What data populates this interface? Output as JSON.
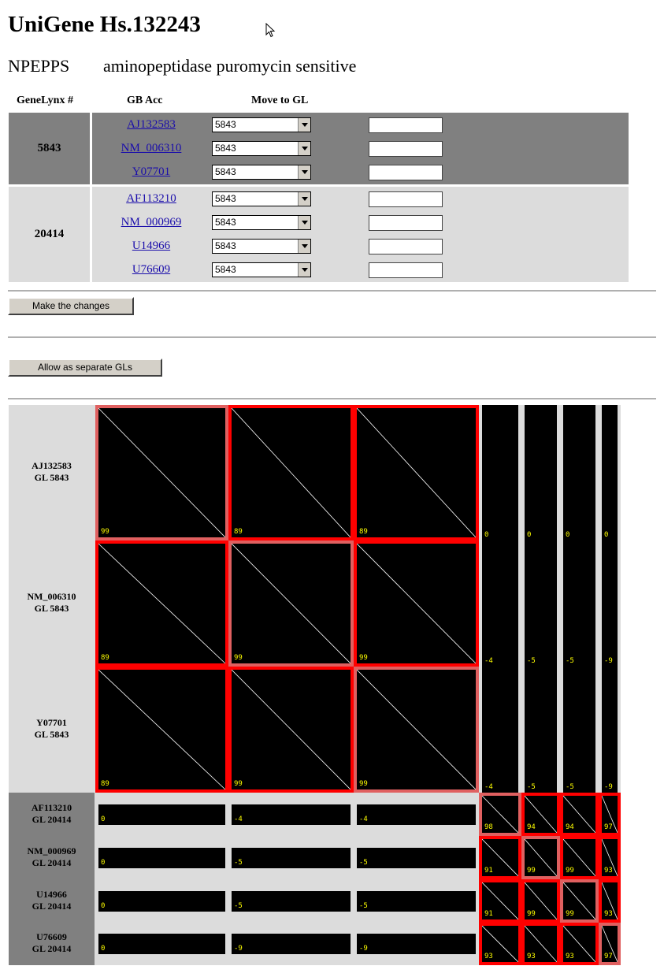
{
  "page": {
    "title": "UniGene Hs.132243",
    "gene_symbol": "NPEPPS",
    "gene_description": "aminopeptidase puromycin sensitive"
  },
  "table": {
    "headers": {
      "genelynx": "GeneLynx #",
      "gb_acc": "GB Acc",
      "move_to_gl": "Move to GL"
    },
    "groups": [
      {
        "gl": "5843",
        "color": "#808080",
        "rows": [
          {
            "acc": "AJ132583",
            "select_value": "5843",
            "input_value": ""
          },
          {
            "acc": "NM_006310",
            "select_value": "5843",
            "input_value": ""
          },
          {
            "acc": "Y07701",
            "select_value": "5843",
            "input_value": ""
          }
        ]
      },
      {
        "gl": "20414",
        "color": "#dcdcdc",
        "rows": [
          {
            "acc": "AF113210",
            "select_value": "5843",
            "input_value": ""
          },
          {
            "acc": "NM_000969",
            "select_value": "5843",
            "input_value": ""
          },
          {
            "acc": "U14966",
            "select_value": "5843",
            "input_value": ""
          },
          {
            "acc": "U76609",
            "select_value": "5843",
            "input_value": ""
          }
        ]
      }
    ]
  },
  "buttons": {
    "make_changes": "Make the changes",
    "allow_separate": "Allow as separate GLs"
  },
  "matrix": {
    "rows": [
      {
        "acc": "AJ132583",
        "gl": "GL 5843"
      },
      {
        "acc": "NM_006310",
        "gl": "GL 5843"
      },
      {
        "acc": "Y07701",
        "gl": "GL 5843"
      },
      {
        "acc": "AF113210",
        "gl": "GL 20414"
      },
      {
        "acc": "NM_000969",
        "gl": "GL 20414"
      },
      {
        "acc": "U14966",
        "gl": "GL 20414"
      },
      {
        "acc": "U76609",
        "gl": "GL 20414"
      }
    ],
    "scores": [
      [
        "99",
        "89",
        "89",
        "0",
        "0",
        "0",
        "0"
      ],
      [
        "89",
        "99",
        "99",
        "-4",
        "-5",
        "-5",
        "-9"
      ],
      [
        "89",
        "99",
        "99",
        "-4",
        "-5",
        "-5",
        "-9"
      ],
      [
        "0",
        "-4",
        "-4",
        "98",
        "94",
        "94",
        "97"
      ],
      [
        "0",
        "-5",
        "-5",
        "91",
        "99",
        "99",
        "93"
      ],
      [
        "0",
        "-5",
        "-5",
        "91",
        "99",
        "99",
        "93"
      ],
      [
        "0",
        "-9",
        "-9",
        "93",
        "93",
        "93",
        "97"
      ]
    ],
    "colors": {
      "same_group": "#ff0000",
      "self": "#e06060",
      "group1_label_bg": "#dcdcdc",
      "group2_label_bg": "#808080"
    }
  }
}
